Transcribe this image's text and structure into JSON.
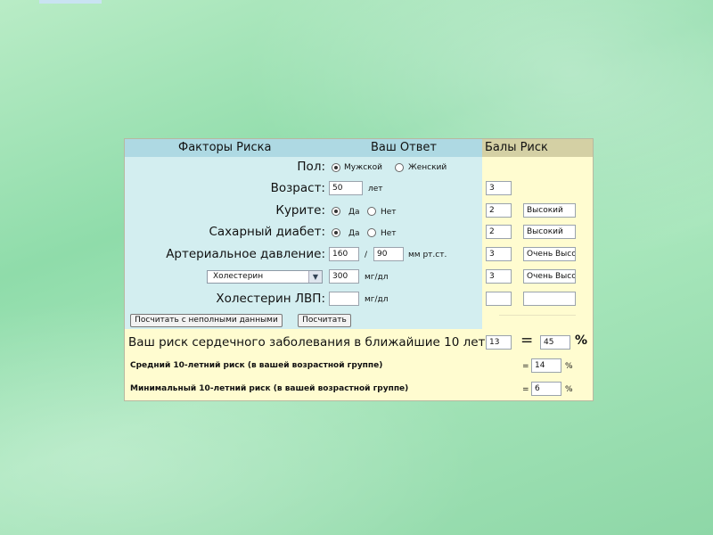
{
  "header": {
    "col1": "Факторы Риска",
    "col2": "Ваш Ответ",
    "col3": "Балы Риск"
  },
  "rows": {
    "gender": {
      "label": "Пол:",
      "option_male": "Мужской",
      "option_female": "Женский",
      "selected": "Мужской"
    },
    "age": {
      "label": "Возраст:",
      "value": "50",
      "unit": "лет",
      "points": "3",
      "risk": ""
    },
    "smoking": {
      "label": "Курите:",
      "option_yes": "Да",
      "option_no": "Нет",
      "selected": "Да",
      "points": "2",
      "risk": "Высокий"
    },
    "diabetes": {
      "label": "Сахарный диабет:",
      "option_yes": "Да",
      "option_no": "Нет",
      "selected": "Да",
      "points": "2",
      "risk": "Высокий"
    },
    "pressure": {
      "label": "Артериальное давление:",
      "systolic": "160",
      "separator": "/",
      "diastolic": "90",
      "unit": "мм рт.ст.",
      "points": "3",
      "risk": "Очень Высо"
    },
    "cholesterol": {
      "select_value": "Холестерин",
      "value": "300",
      "unit": "мг/дл",
      "points": "3",
      "risk": "Очень Высо"
    },
    "hdl": {
      "label": "Холестерин ЛВП:",
      "value": "",
      "unit": "мг/дл",
      "points": "",
      "risk": ""
    }
  },
  "buttons": {
    "partial": "Посчитать с неполными данными",
    "calculate": "Посчитать"
  },
  "results": {
    "your_risk_label": "Ваш риск сердечного заболевания в ближайшие 10 лет",
    "your_risk_points": "13",
    "equals": "=",
    "your_risk_percent": "45",
    "percent": "%",
    "avg_label": "Средний 10-летний риск (в вашей возрастной группе)",
    "avg_value": "14",
    "min_label": "Минимальный 10-летний риск (в вашей возрастной группе)",
    "min_value": "6"
  }
}
